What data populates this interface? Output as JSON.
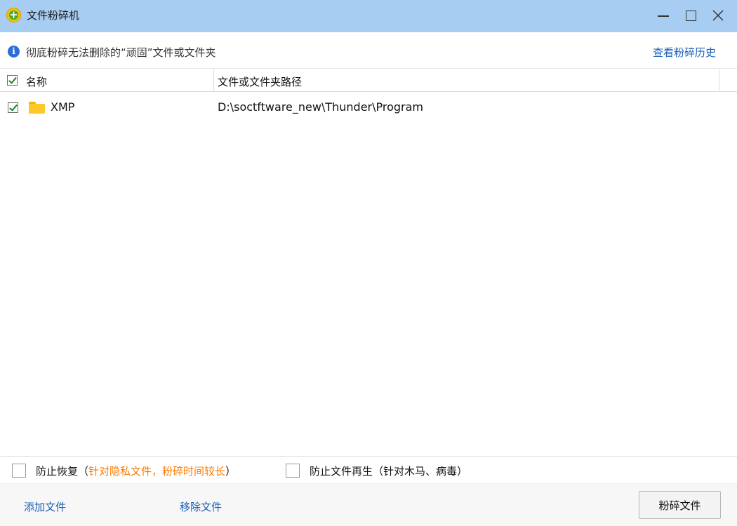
{
  "window": {
    "title": "文件粉碎机",
    "logo_icon": "360-shredder-logo",
    "controls": [
      "minimize-icon",
      "maximize-icon",
      "close-icon"
    ]
  },
  "info": {
    "icon": "info-icon",
    "icon_glyph": "i",
    "text": "彻底粉碎无法删除的“顽固”文件或文件夹",
    "history_link": "查看粉碎历史"
  },
  "table": {
    "header_checked": true,
    "columns": [
      "名称",
      "文件或文件夹路径"
    ],
    "rows": [
      {
        "checked": true,
        "icon": "folder-icon",
        "name": "XMP",
        "path": "D:\\soctftware_new\\Thunder\\Program"
      }
    ]
  },
  "options": {
    "prevent_recovery": {
      "checked": false,
      "label": "防止恢复（",
      "note": "针对隐私文件，粉碎时间较长",
      "close": "）"
    },
    "prevent_regeneration": {
      "checked": false,
      "label": "防止文件再生（针对木马、病毒）"
    }
  },
  "actions": {
    "add_files": "添加文件",
    "remove_files": "移除文件",
    "shred_button": "粉碎文件"
  },
  "colors": {
    "titlebar": "#a8cdf3",
    "link": "#1c5fb7",
    "warning": "#ff7a00",
    "check": "#1f7e2a"
  }
}
